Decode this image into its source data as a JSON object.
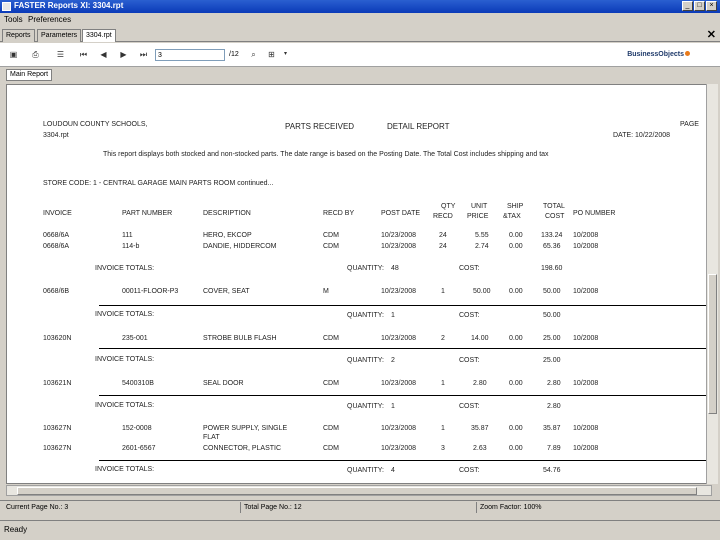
{
  "window": {
    "title": "FASTER Reports XI: 3304.rpt"
  },
  "menu": [
    "Tools",
    "Preferences"
  ],
  "tabs": [
    "Reports",
    "Parameters",
    "3304.rpt"
  ],
  "toolbar": {
    "page_value": "3",
    "page_total": "/12",
    "logo_text": "BusinessObjects"
  },
  "tree": {
    "main_report": "Main Report"
  },
  "report": {
    "org": "LOUDOUN COUNTY SCHOOLS,",
    "filename": "3304.rpt",
    "title_left": "PARTS RECEIVED",
    "title_right": "DETAIL REPORT",
    "page_label": "PAGE",
    "date_label": "DATE: 10/22/2008",
    "description": "This report displays both stocked and non-stocked parts. The date range is based on the Posting Date. The Total Cost includes shipping and tax",
    "store_line": "STORE CODE: 1 - CENTRAL GARAGE MAIN PARTS ROOM continued...",
    "headers": {
      "invoice": "INVOICE",
      "part_number": "PART NUMBER",
      "description": "DESCRIPTION",
      "recd_by": "RECD BY",
      "post_date": "POST DATE",
      "qty_l1": "QTY",
      "qty_l2": "RECD",
      "unit_l1": "UNIT",
      "unit_l2": "PRICE",
      "ship_l1": "SHIP",
      "ship_l2": "&TAX",
      "total_l1": "TOTAL",
      "total_l2": "COST",
      "po_number": "PO NUMBER"
    },
    "rows": [
      {
        "invoice": "0668/6A",
        "part": "111",
        "desc": "HERO, EKCOP",
        "recd_by": "CDM",
        "date": "10/23/2008",
        "qty": "24",
        "unit": "5.55",
        "ship": "0.00",
        "total": "133.24",
        "po": "10/2008"
      },
      {
        "invoice": "0668/6A",
        "part": "114-b",
        "desc": "DANDIE, HIDDERCOM",
        "recd_by": "CDM",
        "date": "10/23/2008",
        "qty": "24",
        "unit": "2.74",
        "ship": "0.00",
        "total": "65.36",
        "po": "10/2008"
      },
      {
        "invoice": "0668/6B",
        "part": "00011-FLOOR-P3",
        "desc": "COVER, SEAT",
        "recd_by": "M",
        "date": "10/23/2008",
        "qty": "1",
        "unit": "50.00",
        "ship": "0.00",
        "total": "50.00",
        "po": "10/2008"
      },
      {
        "invoice": "103620N",
        "part": "235-001",
        "desc": "STROBE BULB FLASH",
        "recd_by": "CDM",
        "date": "10/23/2008",
        "qty": "2",
        "unit": "14.00",
        "ship": "0.00",
        "total": "25.00",
        "po": "10/2008"
      },
      {
        "invoice": "103621N",
        "part": "5400310B",
        "desc": "SEAL DOOR",
        "recd_by": "CDM",
        "date": "10/23/2008",
        "qty": "1",
        "unit": "2.80",
        "ship": "0.00",
        "total": "2.80",
        "po": "10/2008"
      },
      {
        "invoice": "103627N",
        "part": "152-0008",
        "desc": "POWER SUPPLY, SINGLE",
        "desc2": "FLAT",
        "recd_by": "CDM",
        "date": "10/23/2008",
        "qty": "1",
        "unit": "35.87",
        "ship": "0.00",
        "total": "35.87",
        "po": "10/2008"
      },
      {
        "invoice": "103627N",
        "part": "2601-6567",
        "desc": "CONNECTOR, PLASTIC",
        "recd_by": "CDM",
        "date": "10/23/2008",
        "qty": "3",
        "unit": "2.63",
        "ship": "0.00",
        "total": "7.89",
        "po": "10/2008"
      }
    ],
    "totals": [
      {
        "label": "INVOICE TOTALS:",
        "qty_label": "QUANTITY:",
        "qty": "48",
        "cost_label": "COST:",
        "cost": "198.60"
      },
      {
        "label": "INVOICE TOTALS:",
        "qty_label": "QUANTITY:",
        "qty": "1",
        "cost_label": "COST:",
        "cost": "50.00"
      },
      {
        "label": "INVOICE TOTALS:",
        "qty_label": "QUANTITY:",
        "qty": "2",
        "cost_label": "COST:",
        "cost": "25.00"
      },
      {
        "label": "INVOICE TOTALS:",
        "qty_label": "QUANTITY:",
        "qty": "1",
        "cost_label": "COST:",
        "cost": "2.80"
      },
      {
        "label": "INVOICE TOTALS:",
        "qty_label": "QUANTITY:",
        "qty": "4",
        "cost_label": "COST:",
        "cost": "54.76"
      }
    ]
  },
  "infobar": {
    "current_page": "Current Page No.: 3",
    "total_page": "Total Page No.: 12",
    "zoom": "Zoom Factor: 100%"
  },
  "status": {
    "text": "Ready"
  }
}
